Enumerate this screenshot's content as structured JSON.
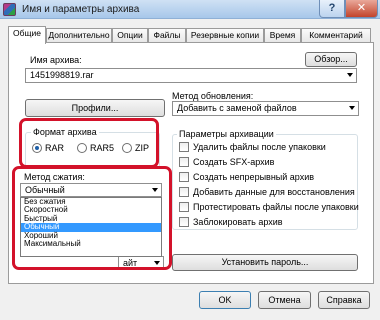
{
  "window": {
    "title": "Имя и параметры архива",
    "help_label": "?",
    "close_label": "✕"
  },
  "tabs": [
    {
      "label": "Общие",
      "active": true
    },
    {
      "label": "Дополнительно",
      "active": false
    },
    {
      "label": "Опции",
      "active": false
    },
    {
      "label": "Файлы",
      "active": false
    },
    {
      "label": "Резервные копии",
      "active": false
    },
    {
      "label": "Время",
      "active": false
    },
    {
      "label": "Комментарий",
      "active": false
    }
  ],
  "archive": {
    "name_label": "Имя архива:",
    "name_value": "1451998819.rar",
    "browse_label": "Обзор...",
    "profiles_label": "Профили...",
    "update_label": "Метод обновления:",
    "update_value": "Добавить с заменой файлов"
  },
  "format": {
    "title": "Формат архива",
    "options": [
      {
        "label": "RAR",
        "selected": true
      },
      {
        "label": "RAR5",
        "selected": false
      },
      {
        "label": "ZIP",
        "selected": false
      }
    ]
  },
  "compression": {
    "label": "Метод сжатия:",
    "value": "Обычный",
    "options": [
      {
        "label": "Без сжатия",
        "selected": false
      },
      {
        "label": "Скоростной",
        "selected": false
      },
      {
        "label": "Быстрый",
        "selected": false
      },
      {
        "label": "Обычный",
        "selected": true
      },
      {
        "label": "Хороший",
        "selected": false
      },
      {
        "label": "Максимальный",
        "selected": false
      }
    ]
  },
  "params": {
    "title": "Параметры архивации",
    "items": [
      "Удалить файлы после упаковки",
      "Создать SFX-архив",
      "Создать непрерывный архив",
      "Добавить данные для восстановления",
      "Протестировать файлы после упаковки",
      "Заблокировать архив"
    ]
  },
  "split": {
    "unit_value": "айт"
  },
  "password_label": "Установить пароль...",
  "footer": {
    "ok_label": "OK",
    "cancel_label": "Отмена",
    "help_label": "Справка"
  },
  "colors": {
    "highlight": "#d3122a",
    "selection": "#3399ff"
  }
}
